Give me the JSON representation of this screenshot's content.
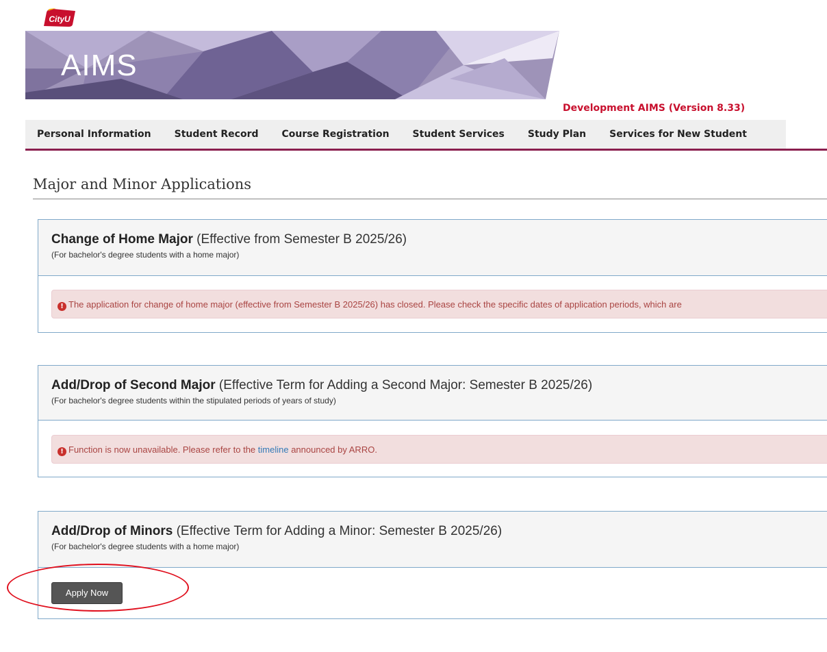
{
  "header": {
    "logo_text": "CityU",
    "banner_title": "AIMS",
    "version_text": "Development AIMS (Version 8.33)"
  },
  "nav": {
    "items": [
      {
        "label": "Personal Information"
      },
      {
        "label": "Student Record"
      },
      {
        "label": "Course Registration"
      },
      {
        "label": "Student Services"
      },
      {
        "label": "Study Plan"
      },
      {
        "label": "Services for New Student"
      }
    ]
  },
  "page": {
    "title": "Major and Minor Applications"
  },
  "sections": [
    {
      "title_bold": "Change of Home Major",
      "title_rest": " (Effective from Semester B 2025/26)",
      "subtitle": "(For bachelor's degree students with a home major)",
      "alert": "The application for change of home major (effective from Semester B 2025/26) has closed. Please check the specific dates of application periods, which are"
    },
    {
      "title_bold": "Add/Drop of Second Major",
      "title_rest": " (Effective Term for Adding a Second Major: Semester B 2025/26)",
      "subtitle": "(For bachelor's degree students within the stipulated periods of years of study)",
      "alert_before": "Function is now unavailable. Please refer to the ",
      "alert_link": "timeline",
      "alert_after": " announced by ARRO."
    },
    {
      "title_bold": "Add/Drop of Minors",
      "title_rest": " (Effective Term for Adding a Minor: Semester B 2025/26)",
      "subtitle": "(For bachelor's degree students with a home major)",
      "button_label": "Apply Now"
    }
  ],
  "colors": {
    "brand_red": "#c8102e",
    "nav_border": "#8a1e4e",
    "panel_border": "#7fa8c9",
    "alert_bg": "#f2dede",
    "alert_text": "#a94442",
    "highlight_circle": "#e0101e"
  }
}
